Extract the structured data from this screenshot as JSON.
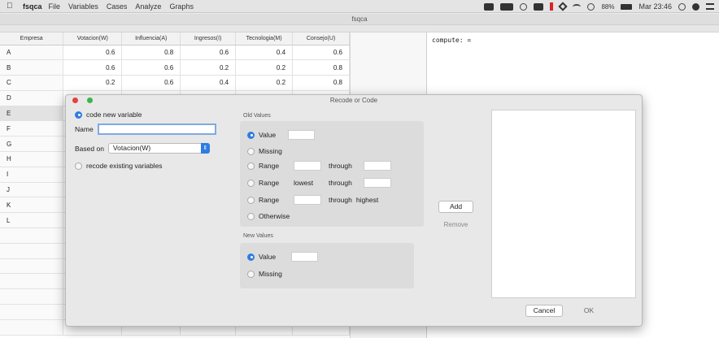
{
  "menubar": {
    "app_name": "fsqca",
    "menus": [
      "File",
      "Variables",
      "Cases",
      "Analyze",
      "Graphs"
    ],
    "status": {
      "battery": "88%",
      "clock": "Mar 23:46"
    }
  },
  "window": {
    "title": "fsqca"
  },
  "grid": {
    "columns": [
      "Empresa",
      "Votacion(W)",
      "Influencia(A)",
      "Ingresos(I)",
      "Tecnologia(M)",
      "Consejo(U)"
    ],
    "rows": [
      {
        "label": "A",
        "values": [
          "0.6",
          "0.8",
          "0.6",
          "0.4",
          "0.6"
        ]
      },
      {
        "label": "B",
        "values": [
          "0.6",
          "0.6",
          "0.2",
          "0.2",
          "0.8"
        ]
      },
      {
        "label": "C",
        "values": [
          "0.2",
          "0.6",
          "0.4",
          "0.2",
          "0.8"
        ]
      },
      {
        "label": "D",
        "values": [
          "",
          "",
          "",
          "",
          ""
        ]
      },
      {
        "label": "E",
        "values": [
          "",
          "",
          "",
          "",
          ""
        ]
      },
      {
        "label": "F",
        "values": [
          "",
          "",
          "",
          "",
          ""
        ]
      },
      {
        "label": "G",
        "values": [
          "",
          "",
          "",
          "",
          ""
        ]
      },
      {
        "label": "H",
        "values": [
          "",
          "",
          "",
          "",
          ""
        ]
      },
      {
        "label": "I",
        "values": [
          "",
          "",
          "",
          "",
          ""
        ]
      },
      {
        "label": "J",
        "values": [
          "",
          "",
          "",
          "",
          ""
        ]
      },
      {
        "label": "K",
        "values": [
          "",
          "",
          "",
          "",
          ""
        ]
      },
      {
        "label": "L",
        "values": [
          "",
          "",
          "",
          "",
          ""
        ]
      },
      {
        "label": "",
        "values": [
          "",
          "",
          "",
          "",
          ""
        ]
      },
      {
        "label": "",
        "values": [
          "",
          "",
          "",
          "",
          ""
        ]
      },
      {
        "label": "",
        "values": [
          "",
          "",
          "",
          "",
          ""
        ]
      },
      {
        "label": "",
        "values": [
          "",
          "",
          "",
          "",
          ""
        ]
      },
      {
        "label": "",
        "values": [
          "",
          "",
          "",
          "",
          ""
        ]
      },
      {
        "label": "",
        "values": [
          "",
          "",
          "",
          "",
          ""
        ]
      },
      {
        "label": "",
        "values": [
          "",
          "",
          "",
          "",
          ""
        ]
      }
    ]
  },
  "syntax": {
    "text": "compute:  ="
  },
  "dialog": {
    "title": "Recode or Code",
    "code_new_variable": "code new variable",
    "name_label": "Name",
    "name_value": "",
    "based_on_label": "Based on",
    "based_on_value": "Votacion(W)",
    "recode_existing": "recode existing variables",
    "old_values": {
      "header": "Old Values",
      "value": "Value",
      "missing": "Missing",
      "range": "Range",
      "through": "through",
      "lowest": "lowest",
      "highest": "highest",
      "otherwise": "Otherwise"
    },
    "new_values": {
      "header": "New Values",
      "value": "Value",
      "missing": "Missing"
    },
    "add": "Add",
    "remove": "Remove",
    "cancel": "Cancel",
    "ok": "OK"
  },
  "colors": {
    "accent": "#2f7de1",
    "close": "#e0443c",
    "zoom": "#39b54a"
  }
}
